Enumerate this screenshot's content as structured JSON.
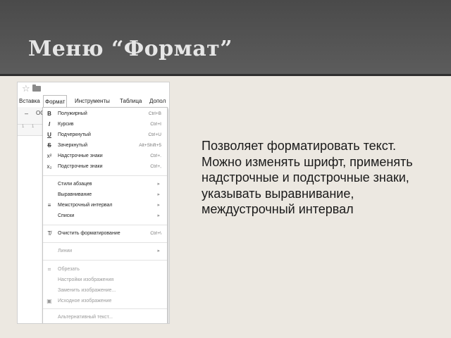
{
  "slide": {
    "title": "Меню “Формат”",
    "description": "Позволяет форматировать текст. Можно изменять шрифт, применять надстрочные и подстрочные знаки, указывать выравнивание, междустрочный интервал"
  },
  "screenshot": {
    "menubar": [
      "Вставка",
      "Формат",
      "Инструменты",
      "Таблица",
      "Допол"
    ],
    "toolbar": {
      "zoom_text": "ОС",
      "ruler_marks": [
        "1",
        "1"
      ]
    },
    "menu": [
      {
        "icon": "B",
        "label": "Полужирный",
        "shortcut": "Ctrl+B",
        "submenu": false,
        "disabled": false
      },
      {
        "icon": "I",
        "label": "Курсив",
        "shortcut": "Ctrl+I",
        "submenu": false,
        "disabled": false
      },
      {
        "icon": "U",
        "label": "Подчеркнутый",
        "shortcut": "Ctrl+U",
        "submenu": false,
        "disabled": false
      },
      {
        "icon": "S",
        "label": "Зачеркнутый",
        "shortcut": "Alt+Shift+5",
        "submenu": false,
        "disabled": false
      },
      {
        "icon": "x²",
        "label": "Надстрочные знаки",
        "shortcut": "Ctrl+.",
        "submenu": false,
        "disabled": false
      },
      {
        "icon": "x₂",
        "label": "Подстрочные знаки",
        "shortcut": "Ctrl+,",
        "submenu": false,
        "disabled": false
      },
      {
        "icon": "",
        "label": "Стили абзацев",
        "shortcut": "",
        "submenu": true,
        "disabled": false
      },
      {
        "icon": "",
        "label": "Выравнивание",
        "shortcut": "",
        "submenu": true,
        "disabled": false
      },
      {
        "icon": "≡",
        "label": "Межстрочный интервал",
        "shortcut": "",
        "submenu": true,
        "disabled": false
      },
      {
        "icon": "",
        "label": "Списки",
        "shortcut": "",
        "submenu": true,
        "disabled": false
      },
      {
        "icon": "T̸",
        "label": "Очистить форматирование",
        "shortcut": "Ctrl+\\",
        "submenu": false,
        "disabled": false
      },
      {
        "icon": "",
        "label": "Линии",
        "shortcut": "",
        "submenu": true,
        "disabled": true
      },
      {
        "icon": "⌗",
        "label": "Обрезать",
        "shortcut": "",
        "submenu": false,
        "disabled": true
      },
      {
        "icon": "",
        "label": "Настройки изображения",
        "shortcut": "",
        "submenu": false,
        "disabled": true
      },
      {
        "icon": "",
        "label": "Заменить изображение...",
        "shortcut": "",
        "submenu": false,
        "disabled": true
      },
      {
        "icon": "▣",
        "label": "Исходное изображение",
        "shortcut": "",
        "submenu": false,
        "disabled": true
      },
      {
        "icon": "",
        "label": "Альтернативный текст...",
        "shortcut": "",
        "submenu": false,
        "disabled": true
      }
    ],
    "submenu_arrow": "▸",
    "star_icon": "☆"
  },
  "colors": {
    "header_bg": "#525252",
    "page_bg": "#ece8e1",
    "title_text": "#e6e6e6"
  }
}
